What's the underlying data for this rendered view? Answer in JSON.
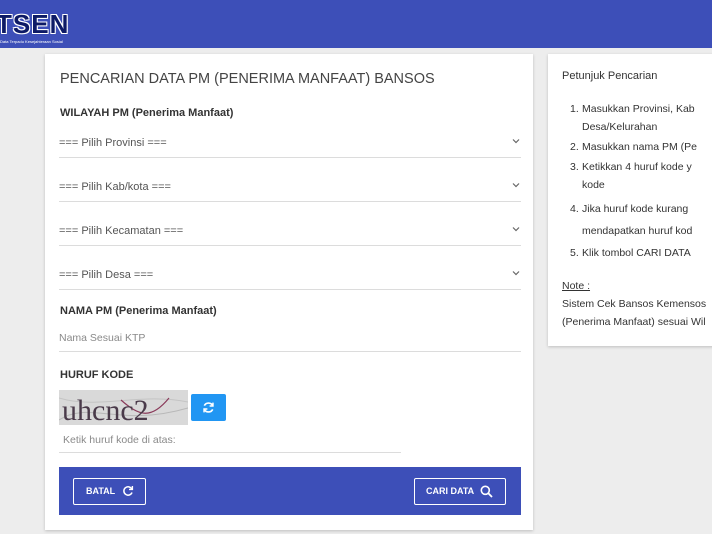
{
  "header": {
    "logo_text": "TSEN",
    "logo_subtitle": "Data Terpadu Kesejahteraan Sosial"
  },
  "form": {
    "title": "PENCARIAN DATA PM (PENERIMA MANFAAT) BANSOS",
    "region_label": "WILAYAH PM (Penerima Manfaat)",
    "province_select": "=== Pilih Provinsi ===",
    "kabkota_select": "=== Pilih Kab/kota ===",
    "kecamatan_select": "=== Pilih Kecamatan ===",
    "desa_select": "=== Pilih Desa ===",
    "name_label": "NAMA PM (Penerima Manfaat)",
    "name_placeholder": "Nama Sesuai KTP",
    "code_label": "HURUF KODE",
    "captcha_text": "uhcnc2",
    "code_placeholder": "Ketik huruf kode di atas:",
    "cancel_label": "BATAL",
    "search_label": "CARI DATA"
  },
  "guide": {
    "title": "Petunjuk Pencarian",
    "items": [
      {
        "num": "1.",
        "line1": "Masukkan Provinsi, Kab",
        "line2": "Desa/Kelurahan"
      },
      {
        "num": "2.",
        "line1": "Masukkan nama PM (Pe"
      },
      {
        "num": "3.",
        "line1": "Ketikkan 4 huruf kode y",
        "line2": "kode"
      },
      {
        "num": "4.",
        "line1": "Jika huruf kode kurang",
        "line2": "mendapatkan huruf kod"
      },
      {
        "num": "5.",
        "line1": "Klik tombol CARI DATA"
      }
    ],
    "note_label": "Note :",
    "note_line1": "Sistem Cek Bansos Kemensos",
    "note_line2": "(Penerima Manfaat) sesuai Wil"
  },
  "colors": {
    "primary": "#3d4fb8",
    "refresh_button": "#2196f3",
    "background": "#ededed"
  }
}
